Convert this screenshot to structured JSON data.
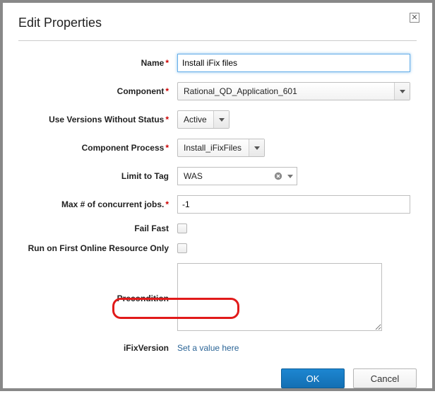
{
  "dialog": {
    "title": "Edit Properties"
  },
  "labels": {
    "name": "Name",
    "component": "Component",
    "versions_no_status": "Use Versions Without Status",
    "component_process": "Component Process",
    "limit_to_tag": "Limit to Tag",
    "max_concurrent": "Max # of concurrent jobs.",
    "fail_fast": "Fail Fast",
    "first_online": "Run on First Online Resource Only",
    "precondition": "Precondition",
    "ifix_version": "iFixVersion"
  },
  "values": {
    "name": "Install iFix files",
    "component": "Rational_QD_Application_601",
    "versions_no_status": "Active",
    "component_process": "Install_iFixFiles",
    "limit_to_tag": "WAS",
    "max_concurrent": "-1",
    "precondition": "",
    "ifix_version_link": "Set a value here"
  },
  "buttons": {
    "ok": "OK",
    "cancel": "Cancel"
  }
}
